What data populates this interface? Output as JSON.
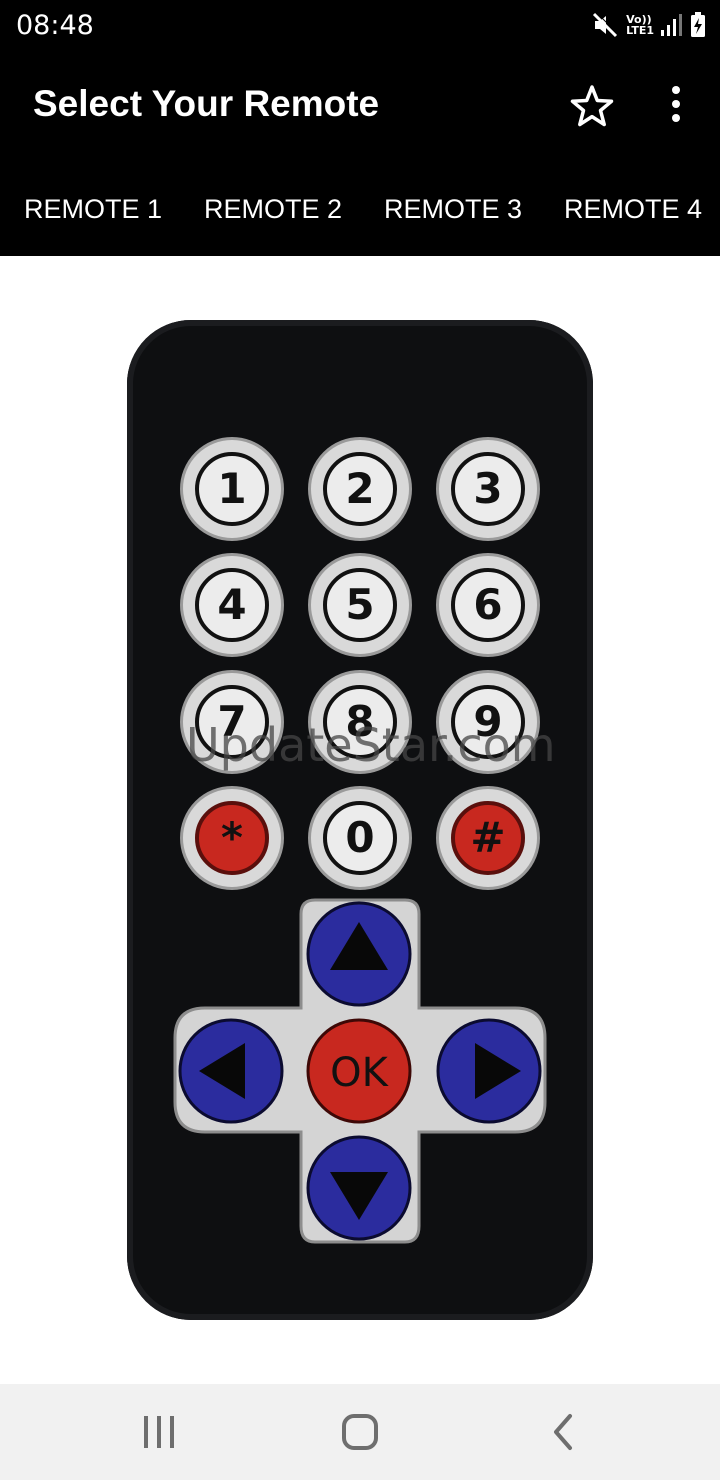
{
  "status_bar": {
    "time": "08:48",
    "network_label_top": "Vo))",
    "network_label_bottom": "LTE1"
  },
  "app_bar": {
    "title": "Select Your Remote",
    "favorite_icon": "star-outline-icon",
    "more_icon": "more-vert-icon"
  },
  "tabs": [
    {
      "label": "REMOTE 1"
    },
    {
      "label": "REMOTE 2"
    },
    {
      "label": "REMOTE 3"
    },
    {
      "label": "REMOTE 4"
    }
  ],
  "remote": {
    "keys": [
      "1",
      "2",
      "3",
      "4",
      "5",
      "6",
      "7",
      "8",
      "9",
      "*",
      "0",
      "#"
    ],
    "ok_label": "OK",
    "colors": {
      "body": "#0e0f11",
      "key": "#d9d9d9",
      "red_key": "#c8281f",
      "blue_key": "#2a2a9a"
    }
  },
  "watermark": "UpdateStar.com",
  "nav_bar": {
    "recents_icon": "recents-icon",
    "home_icon": "home-icon",
    "back_icon": "back-icon"
  }
}
